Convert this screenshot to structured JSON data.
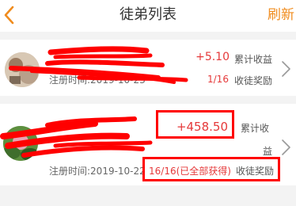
{
  "header": {
    "title": "徒弟列表",
    "refresh_label": "刷新",
    "back_icon": "chevron-left-icon",
    "accent_color": "#f08c1e"
  },
  "apprentices": [
    {
      "name": "",
      "amount": "+5.10",
      "amount_label": "累计收益",
      "reg_time": "注册时间:2019-10-23",
      "progress": "1/16",
      "reward_label": "收徒奖励"
    },
    {
      "name": "",
      "amount": "+458.50",
      "amount_label_line1": "累计收",
      "amount_label_line2": "益",
      "reg_time": "注册时间:2019-10-22",
      "progress": "16/16(已全部获得)",
      "reward_label": "收徒奖励"
    }
  ],
  "colors": {
    "amount_red": "#e5393a",
    "annotation_red": "#ff0000"
  }
}
